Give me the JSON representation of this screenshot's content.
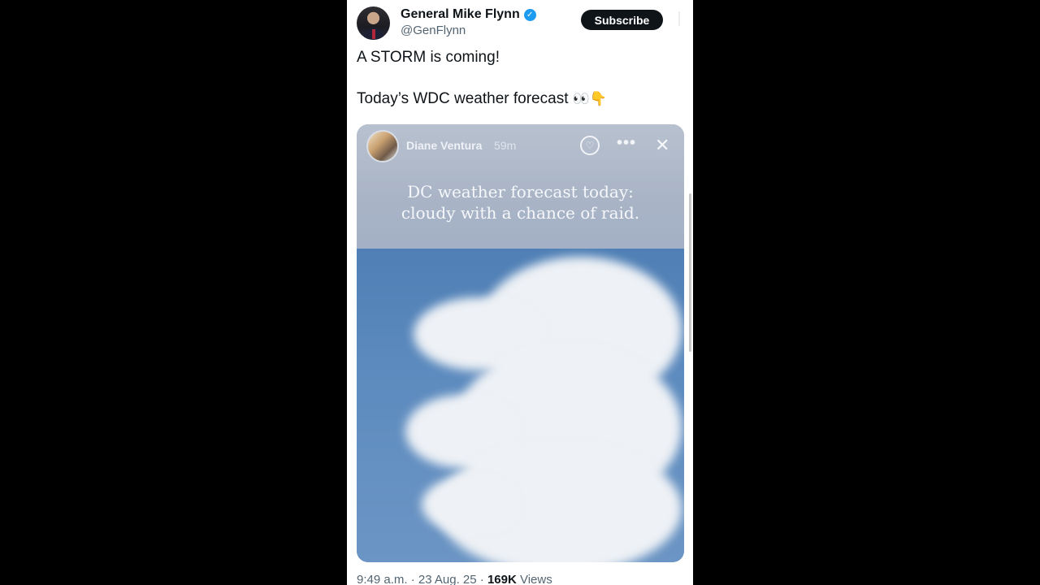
{
  "tweet": {
    "author_name": "General Mike Flynn",
    "handle": "@GenFlynn",
    "verified_mark": "✓",
    "subscribe_label": "Subscribe",
    "line1": "A STORM is coming!",
    "line2": "Today’s WDC weather forecast",
    "line2_emoji": "👀👇",
    "time_date": "9:49 a.m. · 23 Aug. 25 · ",
    "views_count": "169K",
    "views_label": " Views"
  },
  "story": {
    "username": "Diane Ventura",
    "time_ago": "59m",
    "more_glyph": "•••",
    "close_glyph": "✕",
    "like_glyph": "♡",
    "caption_line1": "DC weather forecast today:",
    "caption_line2": "cloudy with a chance of raid."
  },
  "colors": {
    "accent": "#1d9bf0",
    "sky": "#5d8bbf",
    "text": "#0f1419",
    "muted": "#536471"
  }
}
